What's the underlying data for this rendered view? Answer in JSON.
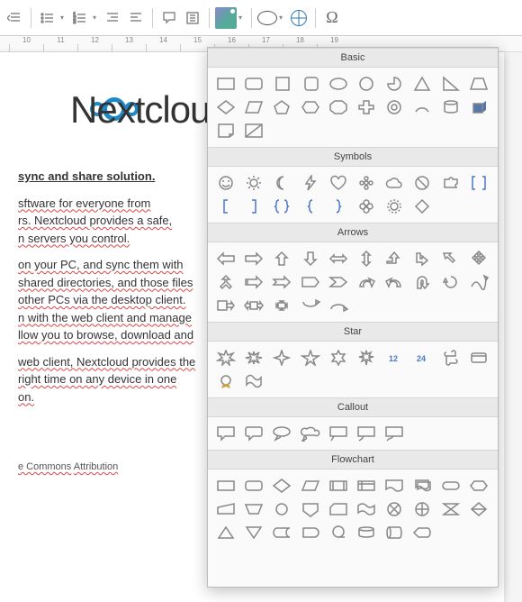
{
  "toolbar": {
    "omega": "Ω"
  },
  "ruler": {
    "ticks": [
      "10",
      "11",
      "12",
      "13",
      "14",
      "15",
      "16",
      "17",
      "18",
      "19"
    ]
  },
  "logo": {
    "text": "Nextclou"
  },
  "doc": {
    "heading": "sync and share solution.",
    "p1a": "sftware for everyone from",
    "p1b": "rs. Nextcloud provides a safe,",
    "p1c": "n servers you control.",
    "p2a": "on your PC, and sync them with",
    "p2b": " shared directories, and those files",
    "p2c": "other PCs via the desktop client.",
    "p2d": "n with the web client and manage",
    "p2e": "llow you to browse, download and",
    "p3a": " web client, Nextcloud provides the",
    "p3b": " right time on any device in one",
    "p3c": "on.",
    "footer_a": "e Commons",
    "footer_b": "Attribution"
  },
  "shapes": {
    "sections": {
      "basic": "Basic",
      "symbols": "Symbols",
      "arrows": "Arrows",
      "star": "Star",
      "callout": "Callout",
      "flowchart": "Flowchart"
    },
    "star_nums": {
      "n12": "12",
      "n24": "24"
    }
  }
}
